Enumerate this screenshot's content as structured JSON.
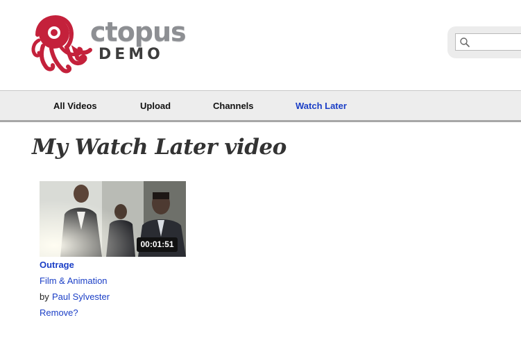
{
  "logo": {
    "word": "ctopus",
    "sub": "DEMO",
    "brand_red": "#c4213b",
    "brand_gray": "#8d8f93"
  },
  "search": {
    "value": "",
    "placeholder": "",
    "icon": "search-icon"
  },
  "nav": {
    "items": [
      {
        "label": "All Videos"
      },
      {
        "label": "Upload"
      },
      {
        "label": "Channels"
      },
      {
        "label": "Watch Later"
      }
    ],
    "active_index": 3,
    "active_color": "#1a3ec6"
  },
  "page": {
    "title": "My Watch Later video"
  },
  "video": {
    "duration": "00:01:51",
    "title": "Outrage",
    "category": "Film & Animation",
    "by_prefix": "by",
    "author": "Paul Sylvester",
    "remove_label": "Remove?"
  }
}
